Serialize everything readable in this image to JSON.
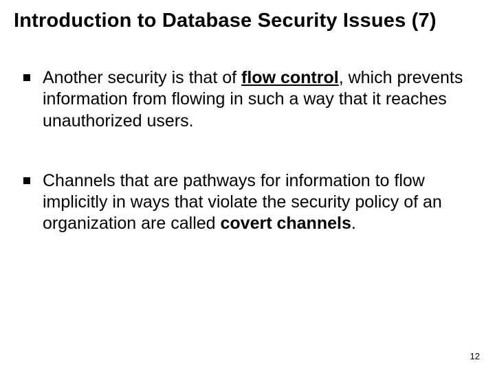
{
  "title": "Introduction to Database Security Issues (7)",
  "bullets": [
    {
      "pre": "Another security is that of ",
      "bold1": "flow control",
      "post": ", which prevents information from flowing in such a way that it reaches unauthorized users."
    },
    {
      "pre": "Channels that are pathways for information to flow implicitly in ways that violate the security policy of an organization are called ",
      "bold1": "covert channels",
      "post": "."
    }
  ],
  "page_number": "12"
}
